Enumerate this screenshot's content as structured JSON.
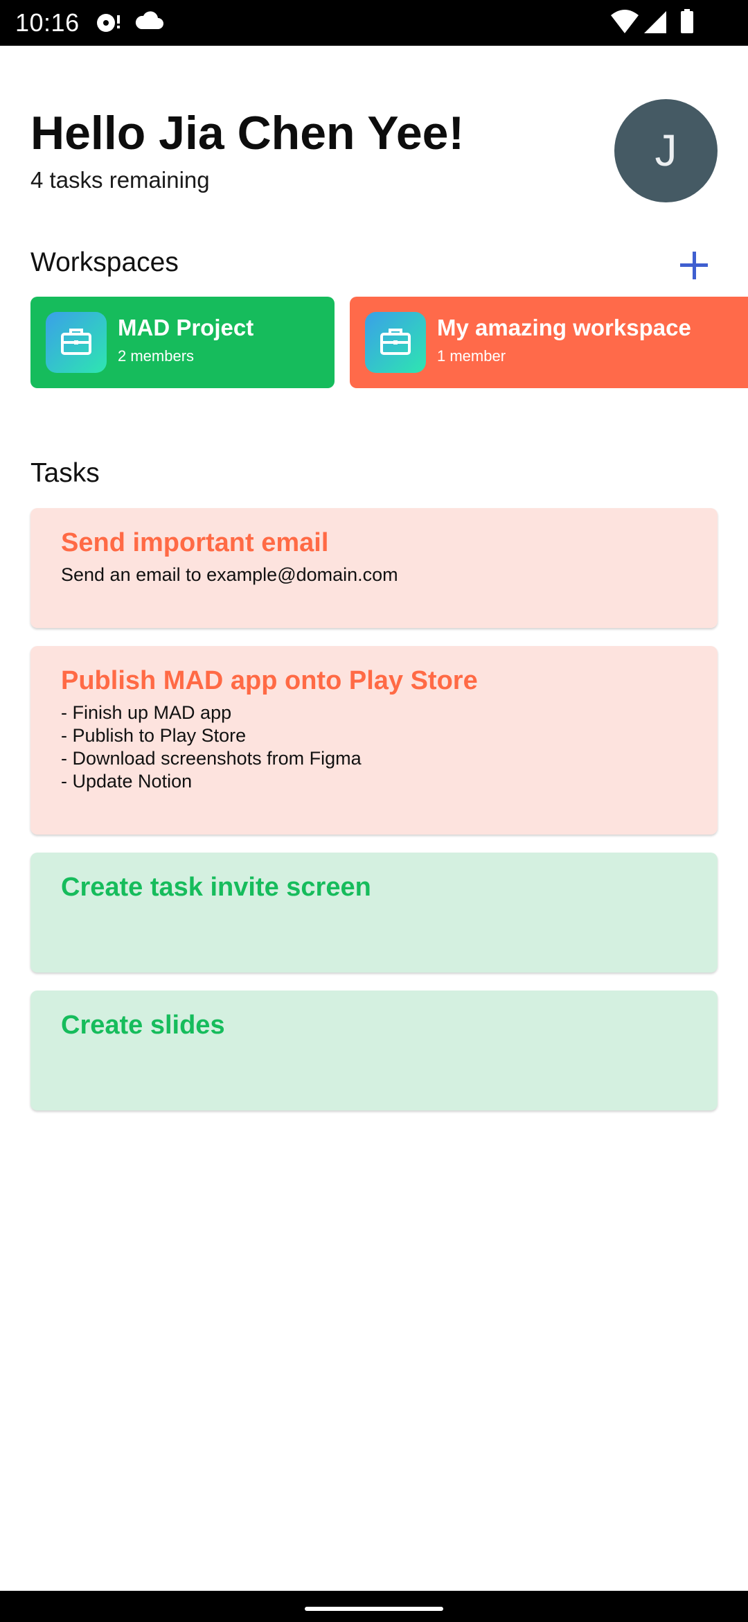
{
  "status_bar": {
    "time": "10:16",
    "icons": [
      "disc-alert-icon",
      "cloud-icon",
      "wifi-icon",
      "cellular-signal-icon",
      "battery-icon"
    ]
  },
  "header": {
    "greeting": "Hello Jia Chen Yee!",
    "tasks_remaining": "4 tasks remaining",
    "avatar_letter": "J",
    "avatar_color": "#455a64"
  },
  "workspaces": {
    "title": "Workspaces",
    "add_icon": "plus-icon",
    "accent": "#3f5fd0",
    "items": [
      {
        "name": "MAD Project",
        "members": "2 members",
        "color": "#16bc5c",
        "icon": "briefcase-icon"
      },
      {
        "name": "My amazing workspace",
        "members": "1 member",
        "color": "#ff6a4a",
        "icon": "briefcase-icon"
      }
    ]
  },
  "tasks": {
    "title": "Tasks",
    "items": [
      {
        "title": "Send important email",
        "description": "Send an email to example@domain.com",
        "bg": "#fde3de",
        "color": "#ff6a45"
      },
      {
        "title": "Publish MAD app onto Play Store",
        "description": "- Finish up MAD app\n- Publish to Play Store\n- Download screenshots from Figma\n- Update Notion",
        "bg": "#fde3de",
        "color": "#ff6a45"
      },
      {
        "title": "Create task invite screen",
        "description": "",
        "bg": "#d4f0e0",
        "color": "#16bc5c"
      },
      {
        "title": "Create slides",
        "description": "",
        "bg": "#d4f0e0",
        "color": "#16bc5c"
      }
    ]
  }
}
